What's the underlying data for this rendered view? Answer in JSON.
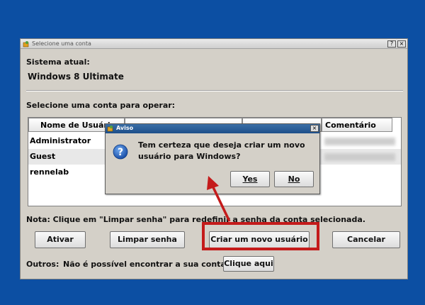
{
  "window": {
    "title": "Selecione uma conta",
    "help_label": "?",
    "close_label": "×"
  },
  "system": {
    "label": "Sistema atual:",
    "value": "Windows 8 Ultimate"
  },
  "accounts": {
    "label": "Selecione uma conta para operar:",
    "columns": [
      "Nome de Usuário",
      "",
      "",
      "Comentário"
    ],
    "rows": [
      {
        "name": "Administrator"
      },
      {
        "name": "Guest"
      },
      {
        "name": "rennelab"
      }
    ]
  },
  "note": "Nota: Clique em \"Limpar senha\" para redefinir a senha da conta selecionada.",
  "buttons": {
    "activate": "Ativar",
    "clear_password": "Limpar senha",
    "create_user": "Criar um novo usuário",
    "cancel": "Cancelar"
  },
  "others": {
    "label": "Outros:",
    "text": "Não é possível encontrar a sua conta?",
    "button": "Clique aqui"
  },
  "dialog": {
    "title": "Aviso",
    "close_label": "×",
    "message_line1": "Tem certeza que deseja criar um novo",
    "message_line2": "usuário para Windows?",
    "yes": "Yes",
    "no": "No",
    "icon": "question-icon"
  },
  "colors": {
    "desktop": "#0c4fa3",
    "highlight": "#c41b1b",
    "dialog_title": "#1d4e8a"
  }
}
